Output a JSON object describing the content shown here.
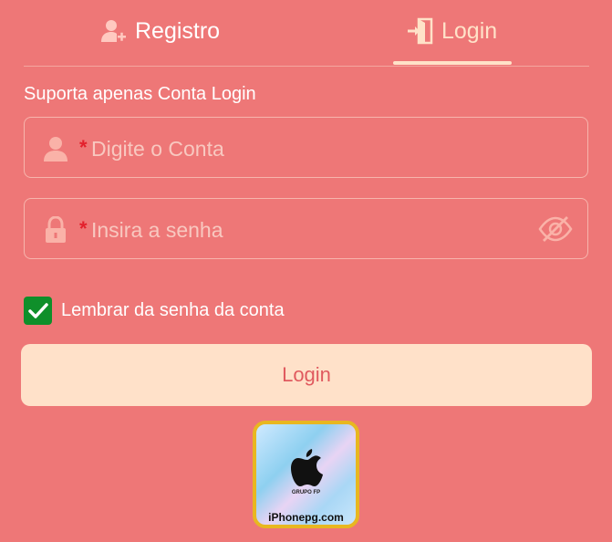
{
  "tabs": {
    "register": {
      "label": "Registro",
      "icon": "user-add-icon"
    },
    "login": {
      "label": "Login",
      "icon": "login-door-icon",
      "active": true
    }
  },
  "notice": "Suporta apenas Conta Login",
  "fields": {
    "account": {
      "placeholder": "Digite o Conta",
      "required_mark": "*",
      "icon": "user-icon",
      "value": ""
    },
    "password": {
      "placeholder": "Insira a senha",
      "required_mark": "*",
      "icon": "lock-icon",
      "toggle_icon": "eye-slash-icon",
      "value": ""
    }
  },
  "remember": {
    "label": "Lembrar da senha da conta",
    "checked": true
  },
  "submit": {
    "label": "Login"
  },
  "app_badge": {
    "brand_text": "GRUPO FP",
    "name": "iPhonepg.com"
  },
  "colors": {
    "background": "#ee7777",
    "button": "#ffe1c9",
    "accent_text": "#e05a5f",
    "checkbox": "#0f8f2a",
    "required": "#e3202c"
  }
}
